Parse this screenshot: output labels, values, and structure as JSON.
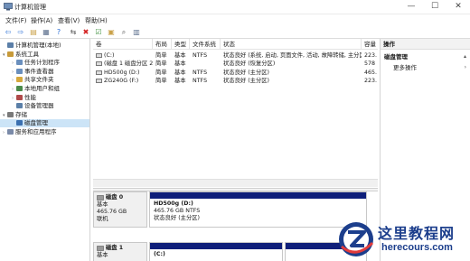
{
  "window": {
    "title": "计算机管理",
    "controls": {
      "minimize": "—",
      "maximize": "☐",
      "close": "✕"
    }
  },
  "menu": [
    "文件(F)",
    "操作(A)",
    "查看(V)",
    "帮助(H)"
  ],
  "toolbar": {
    "icons": [
      "back-icon",
      "forward-icon",
      "folder-icon",
      "properties-icon",
      "help-icon",
      "connect-icon",
      "delete-icon",
      "checkbox-icon",
      "folder-open-icon",
      "search-icon",
      "view-icon"
    ],
    "glyphs": [
      "⇦",
      "⇨",
      "▤",
      "▦",
      "?",
      "⇆",
      "✖",
      "☑",
      "▣",
      "⌕",
      "▥"
    ],
    "colors": [
      "#2a6fd6",
      "#2a6fd6",
      "#caa24a",
      "#5a6e8c",
      "#2a6fd6",
      "#555555",
      "#d42020",
      "#3b8e3b",
      "#caa24a",
      "#555555",
      "#5a6e8c"
    ]
  },
  "tree": [
    {
      "label": "计算机管理(本地)",
      "arrow": "",
      "indent": 0,
      "icon_color": "#5b7fa8",
      "icon": "computer-icon"
    },
    {
      "label": "系统工具",
      "arrow": "▾",
      "indent": 0,
      "icon_color": "#c79a3a",
      "icon": "tools-icon"
    },
    {
      "label": "任务计划程序",
      "arrow": "›",
      "indent": 1,
      "icon_color": "#6a8fbd",
      "icon": "clock-icon"
    },
    {
      "label": "事件查看器",
      "arrow": "›",
      "indent": 1,
      "icon_color": "#6a8fbd",
      "icon": "event-icon"
    },
    {
      "label": "共享文件夹",
      "arrow": "›",
      "indent": 1,
      "icon_color": "#d6a83c",
      "icon": "folder-icon"
    },
    {
      "label": "本地用户和组",
      "arrow": "›",
      "indent": 1,
      "icon_color": "#4a8a4a",
      "icon": "users-icon"
    },
    {
      "label": "性能",
      "arrow": "›",
      "indent": 1,
      "icon_color": "#b04a4a",
      "icon": "performance-icon"
    },
    {
      "label": "设备管理器",
      "arrow": "",
      "indent": 1,
      "icon_color": "#5b7fa8",
      "icon": "device-icon"
    },
    {
      "label": "存储",
      "arrow": "▾",
      "indent": 0,
      "icon_color": "#7a7a7a",
      "icon": "storage-icon"
    },
    {
      "label": "磁盘管理",
      "arrow": "",
      "indent": 1,
      "icon_color": "#3a6fb0",
      "icon": "disk-icon",
      "selected": true
    },
    {
      "label": "服务和应用程序",
      "arrow": "›",
      "indent": 0,
      "icon_color": "#7a8aa8",
      "icon": "services-icon"
    }
  ],
  "volume_table": {
    "headers": [
      "卷",
      "布局",
      "类型",
      "文件系统",
      "状态",
      "容量"
    ],
    "rows": [
      [
        "(C:)",
        "简单",
        "基本",
        "NTFS",
        "状态良好 (系统, 启动, 页面文件, 活动, 故障转储, 主分区)",
        "223."
      ],
      [
        "(磁盘 1 磁盘分区 2)",
        "简单",
        "基本",
        "",
        "状态良好 (恢复分区)",
        "578"
      ],
      [
        "HD500g (D:)",
        "简单",
        "基本",
        "NTFS",
        "状态良好 (主分区)",
        "465."
      ],
      [
        "ZG240G (F:)",
        "简单",
        "基本",
        "NTFS",
        "状态良好 (主分区)",
        "223."
      ]
    ]
  },
  "disks": [
    {
      "name": "磁盘 0",
      "type": "基本",
      "size": "465.76 GB",
      "status": "联机",
      "partition": {
        "name": "HD500g  (D:)",
        "size_fs": "465.76 GB NTFS",
        "status": "状态良好 (主分区)"
      }
    },
    {
      "name": "磁盘 1",
      "type": "基本",
      "partition": {
        "name": "(C:)"
      }
    }
  ],
  "actions": {
    "header": "操作",
    "items": [
      {
        "label": "磁盘管理",
        "chev": "▴"
      },
      {
        "label": "更多操作",
        "chev": "›"
      }
    ]
  },
  "watermark": {
    "cn": "这里教程网",
    "en": "herecours.com"
  }
}
